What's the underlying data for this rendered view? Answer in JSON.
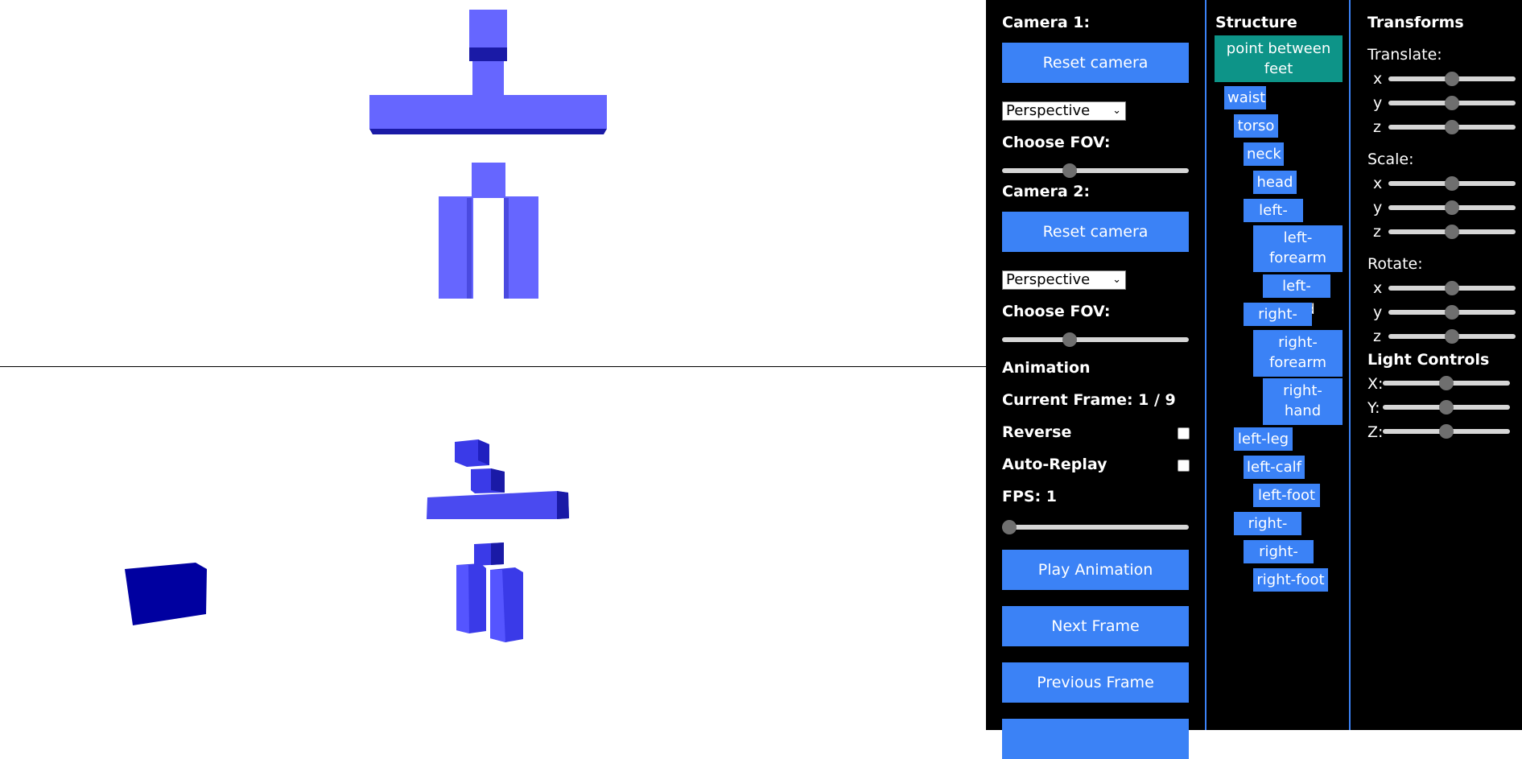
{
  "camera_panel": {
    "camera1_title": "Camera 1:",
    "camera1_reset": "Reset camera",
    "camera1_projection": "Perspective",
    "camera1_fov_label": "Choose FOV:",
    "camera1_fov_value": 0.35,
    "camera2_title": "Camera 2:",
    "camera2_reset": "Reset camera",
    "camera2_projection": "Perspective",
    "camera2_fov_label": "Choose FOV:",
    "camera2_fov_value": 0.35
  },
  "animation": {
    "title": "Animation",
    "current_frame": "Current Frame: 1 / 9",
    "reverse_label": "Reverse",
    "reverse_checked": false,
    "autoreplay_label": "Auto-Replay",
    "autoreplay_checked": false,
    "fps_label": "FPS: 1",
    "fps_value": 0.0,
    "play_button": "Play Animation",
    "next_button": "Next Frame",
    "prev_button": "Previous Frame"
  },
  "structure": {
    "title": "Structure",
    "nodes": [
      {
        "label": "point between feet",
        "selected": true
      },
      {
        "label": "waist"
      },
      {
        "label": "torso"
      },
      {
        "label": "neck"
      },
      {
        "label": "head"
      },
      {
        "label": "left-arm"
      },
      {
        "label": "left-forearm"
      },
      {
        "label": "left-hand"
      },
      {
        "label": "right-arm"
      },
      {
        "label": "right-forearm"
      },
      {
        "label": "right-hand"
      },
      {
        "label": "left-leg"
      },
      {
        "label": "left-calf"
      },
      {
        "label": "left-foot"
      },
      {
        "label": "right-leg"
      },
      {
        "label": "right-calf"
      },
      {
        "label": "right-foot"
      }
    ]
  },
  "transforms": {
    "title": "Transforms",
    "translate_label": "Translate:",
    "translate": [
      {
        "axis": "x",
        "value": 0.5
      },
      {
        "axis": "y",
        "value": 0.5
      },
      {
        "axis": "z",
        "value": 0.5
      }
    ],
    "scale_label": "Scale:",
    "scale": [
      {
        "axis": "x",
        "value": 0.5
      },
      {
        "axis": "y",
        "value": 0.5
      },
      {
        "axis": "z",
        "value": 0.5
      }
    ],
    "rotate_label": "Rotate:",
    "rotate": [
      {
        "axis": "x",
        "value": 0.5
      },
      {
        "axis": "y",
        "value": 0.5
      },
      {
        "axis": "z",
        "value": 0.5
      }
    ],
    "light_label": "Light Controls",
    "light": [
      {
        "axis": "X:",
        "value": 0.5
      },
      {
        "axis": "Y:",
        "value": 0.5
      },
      {
        "axis": "Z:",
        "value": 0.5
      }
    ]
  },
  "colors": {
    "button": "#3b82f6",
    "selected_node": "#0d9488",
    "model_light": "#6666ff",
    "model_dark": "#1a1aa6",
    "cube_dark": "#0000a0"
  }
}
